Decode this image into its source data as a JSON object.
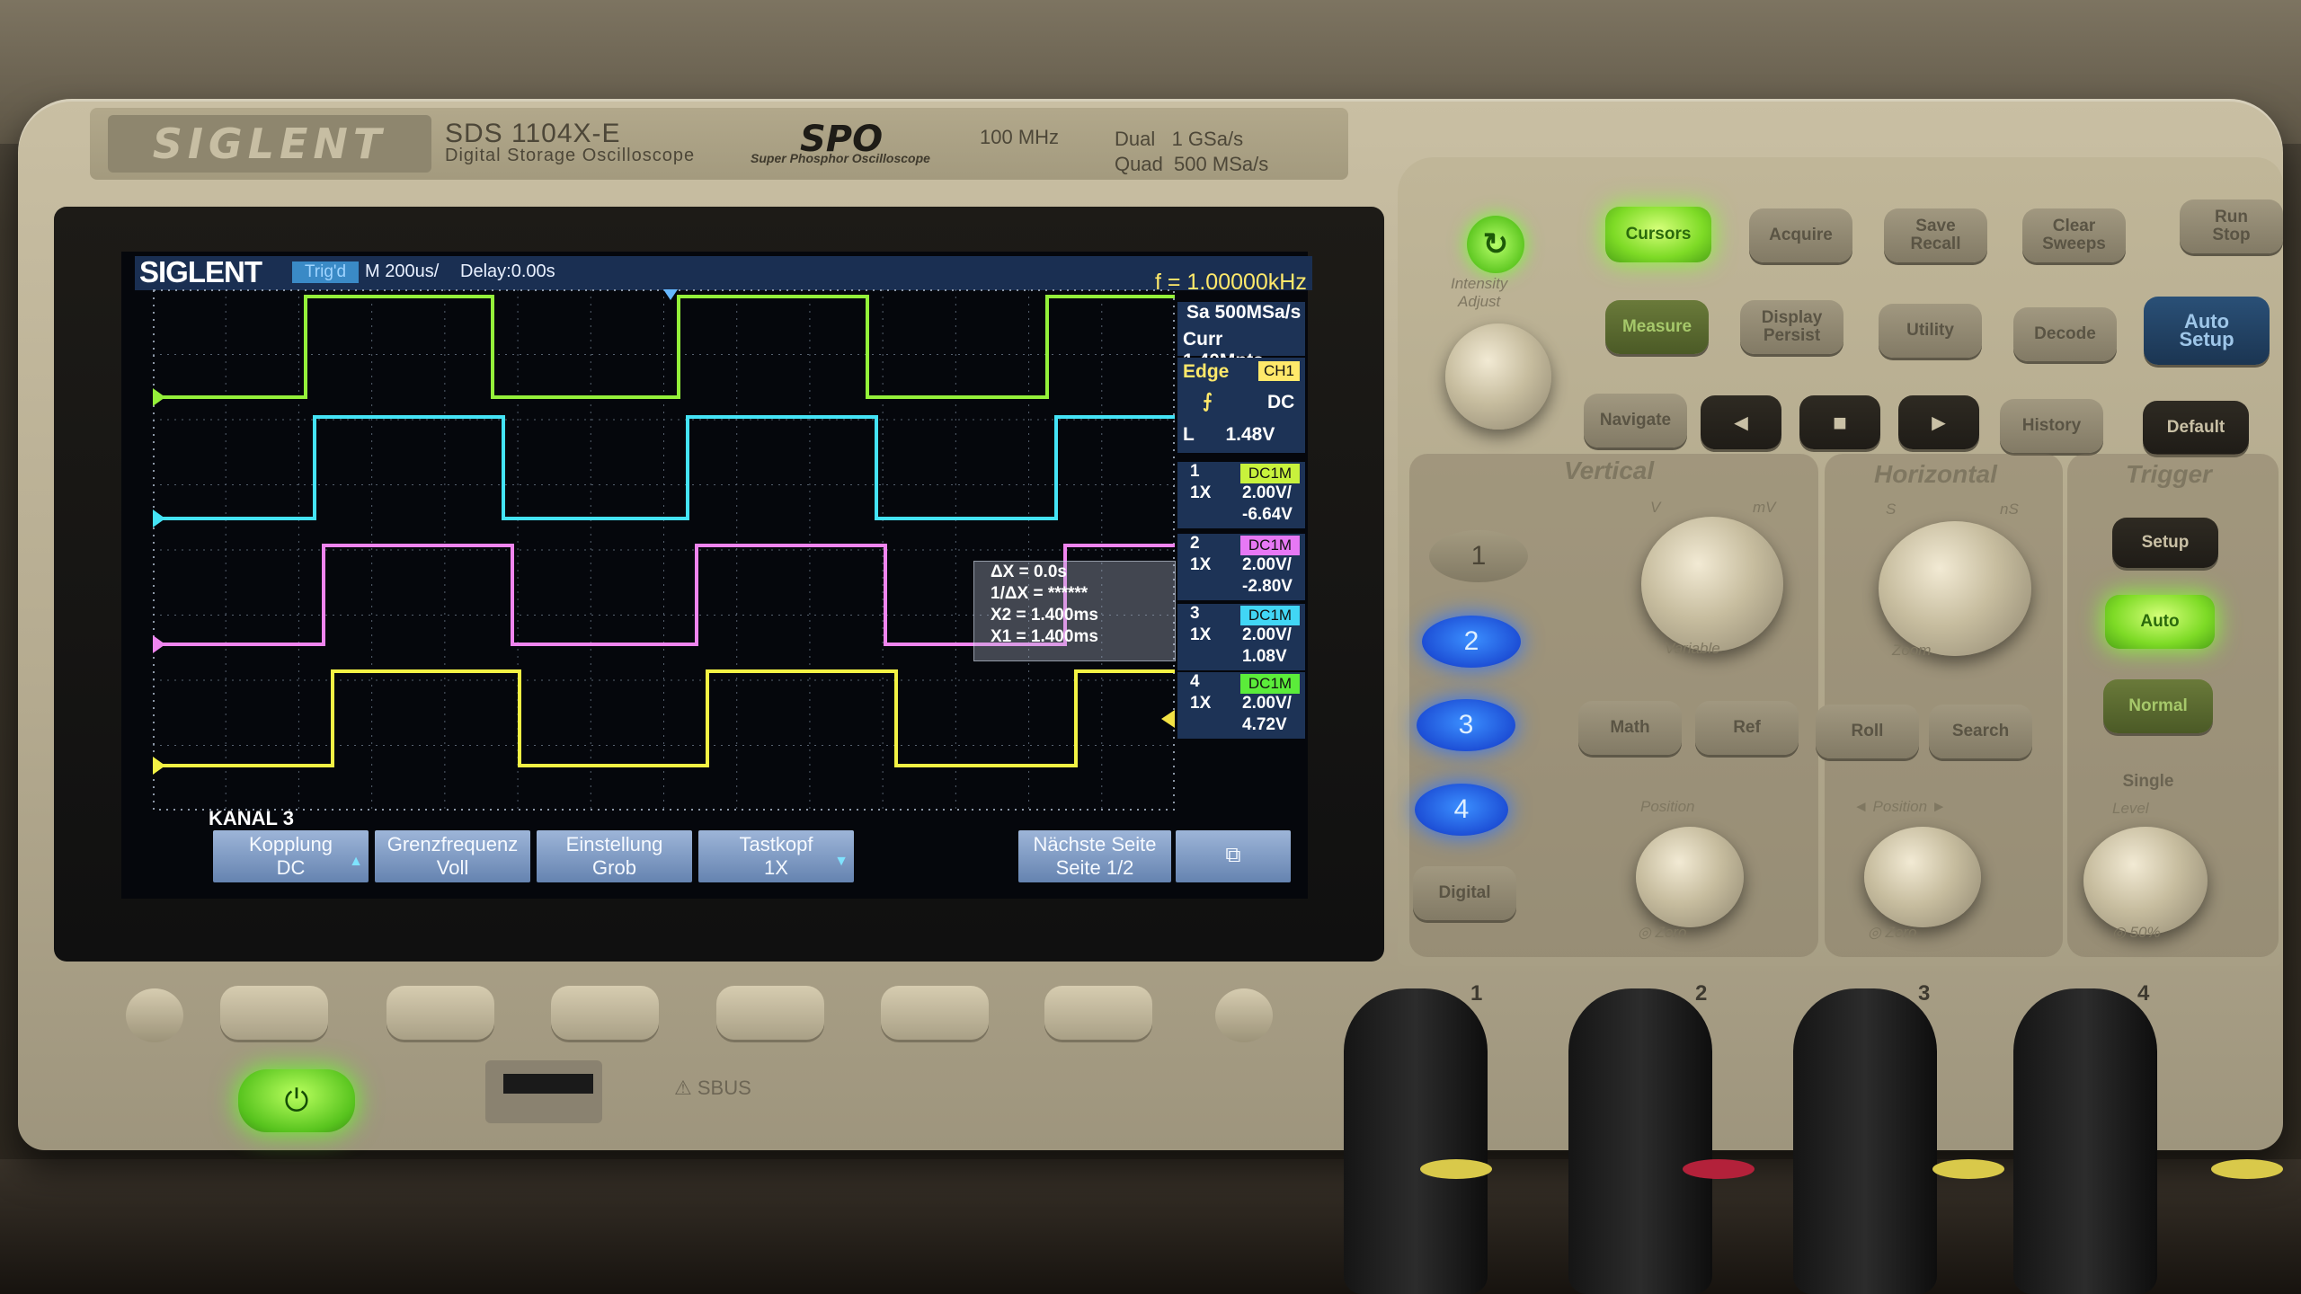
{
  "device": {
    "brand": "SIGLENT",
    "model": "SDS 1104X-E",
    "model_subtitle": "Digital Storage Oscilloscope",
    "spo_logo": "SPO",
    "spo_subtitle": "Super Phosphor Oscilloscope",
    "bandwidth": "100 MHz",
    "sample_dual": "Dual   1 GSa/s",
    "sample_quad": "Quad  500 MSa/s"
  },
  "screen": {
    "logo": "SIGLENT",
    "trig_status": "Trig'd",
    "timebase": "M 200us/",
    "delay": "Delay:0.00s",
    "frequency": "f = 1.00000kHz",
    "sample_rate": "Sa 500MSa/s",
    "memory_depth": "Curr 1.40Mpts",
    "trigger": {
      "type": "Edge",
      "source": "CH1",
      "slope_icon": "rising-edge-icon",
      "coupling": "DC",
      "level": "L      1.48V"
    },
    "channels": [
      {
        "num": "1",
        "coupling": "DC1M",
        "probe": "1X",
        "scale": "2.00V/",
        "offset": "-6.64V",
        "color": "#c8f23c"
      },
      {
        "num": "2",
        "coupling": "DC1M",
        "probe": "1X",
        "scale": "2.00V/",
        "offset": "-2.80V",
        "color": "#e778f5"
      },
      {
        "num": "3",
        "coupling": "DC1M",
        "probe": "1X",
        "scale": "2.00V/",
        "offset": "1.08V",
        "color": "#41d6f5"
      },
      {
        "num": "4",
        "coupling": "DC1M",
        "probe": "1X",
        "scale": "2.00V/",
        "offset": "4.72V",
        "color": "#5bec3a"
      }
    ],
    "cursors": {
      "dx": "ΔX = 0.0s",
      "inv_dx": "1/ΔX = ******",
      "x2": "X2 = 1.400ms",
      "x1": "X1 = 1.400ms"
    },
    "menu_title": "KANAL 3",
    "softkeys": [
      {
        "line1": "Kopplung",
        "line2": "DC"
      },
      {
        "line1": "Grenzfrequenz",
        "line2": "Voll"
      },
      {
        "line1": "Einstellung",
        "line2": "Grob"
      },
      {
        "line1": "Tastkopf",
        "line2": "1X"
      },
      {
        "line1": "Nächste Seite",
        "line2": "Seite 1/2"
      }
    ],
    "network_icon": "network-icon"
  },
  "panel": {
    "intensity_label": "Intensity\nAdjust",
    "adjust_label": "Adjust",
    "buttons": {
      "cursors": "Cursors",
      "acquire": "Acquire",
      "save_recall": "Save\nRecall",
      "clear_sweeps": "Clear\nSweeps",
      "run_stop": "Run\nStop",
      "measure": "Measure",
      "display_persist": "Display\nPersist",
      "utility": "Utility",
      "decode": "Decode",
      "auto_setup": "Auto\nSetup",
      "navigate": "Navigate",
      "history": "History",
      "default": "Default",
      "math": "Math",
      "ref": "Ref",
      "roll": "Roll",
      "search": "Search",
      "digital": "Digital",
      "trig_setup": "Setup",
      "trig_auto": "Auto",
      "trig_normal": "Normal",
      "trig_single": "Single"
    },
    "sections": {
      "vertical": "Vertical",
      "horizontal": "Horizontal",
      "trigger": "Trigger"
    },
    "channel_buttons": [
      "1",
      "2",
      "3",
      "4"
    ],
    "knob_labels": {
      "variable": "Variable",
      "zoom": "Zoom",
      "position_v": "Position",
      "position_h": "◄ Position ►",
      "zero_v": "◎ Zero",
      "zero_h": "◎ Zero",
      "level": "Level",
      "zero_t": "◎ 50%",
      "v_unit": "V",
      "mv_unit": "mV",
      "s_unit": "S",
      "ns_unit": "nS"
    },
    "bnc_numbers": [
      "1",
      "2",
      "3",
      "4"
    ],
    "sbus": "SBUS"
  }
}
